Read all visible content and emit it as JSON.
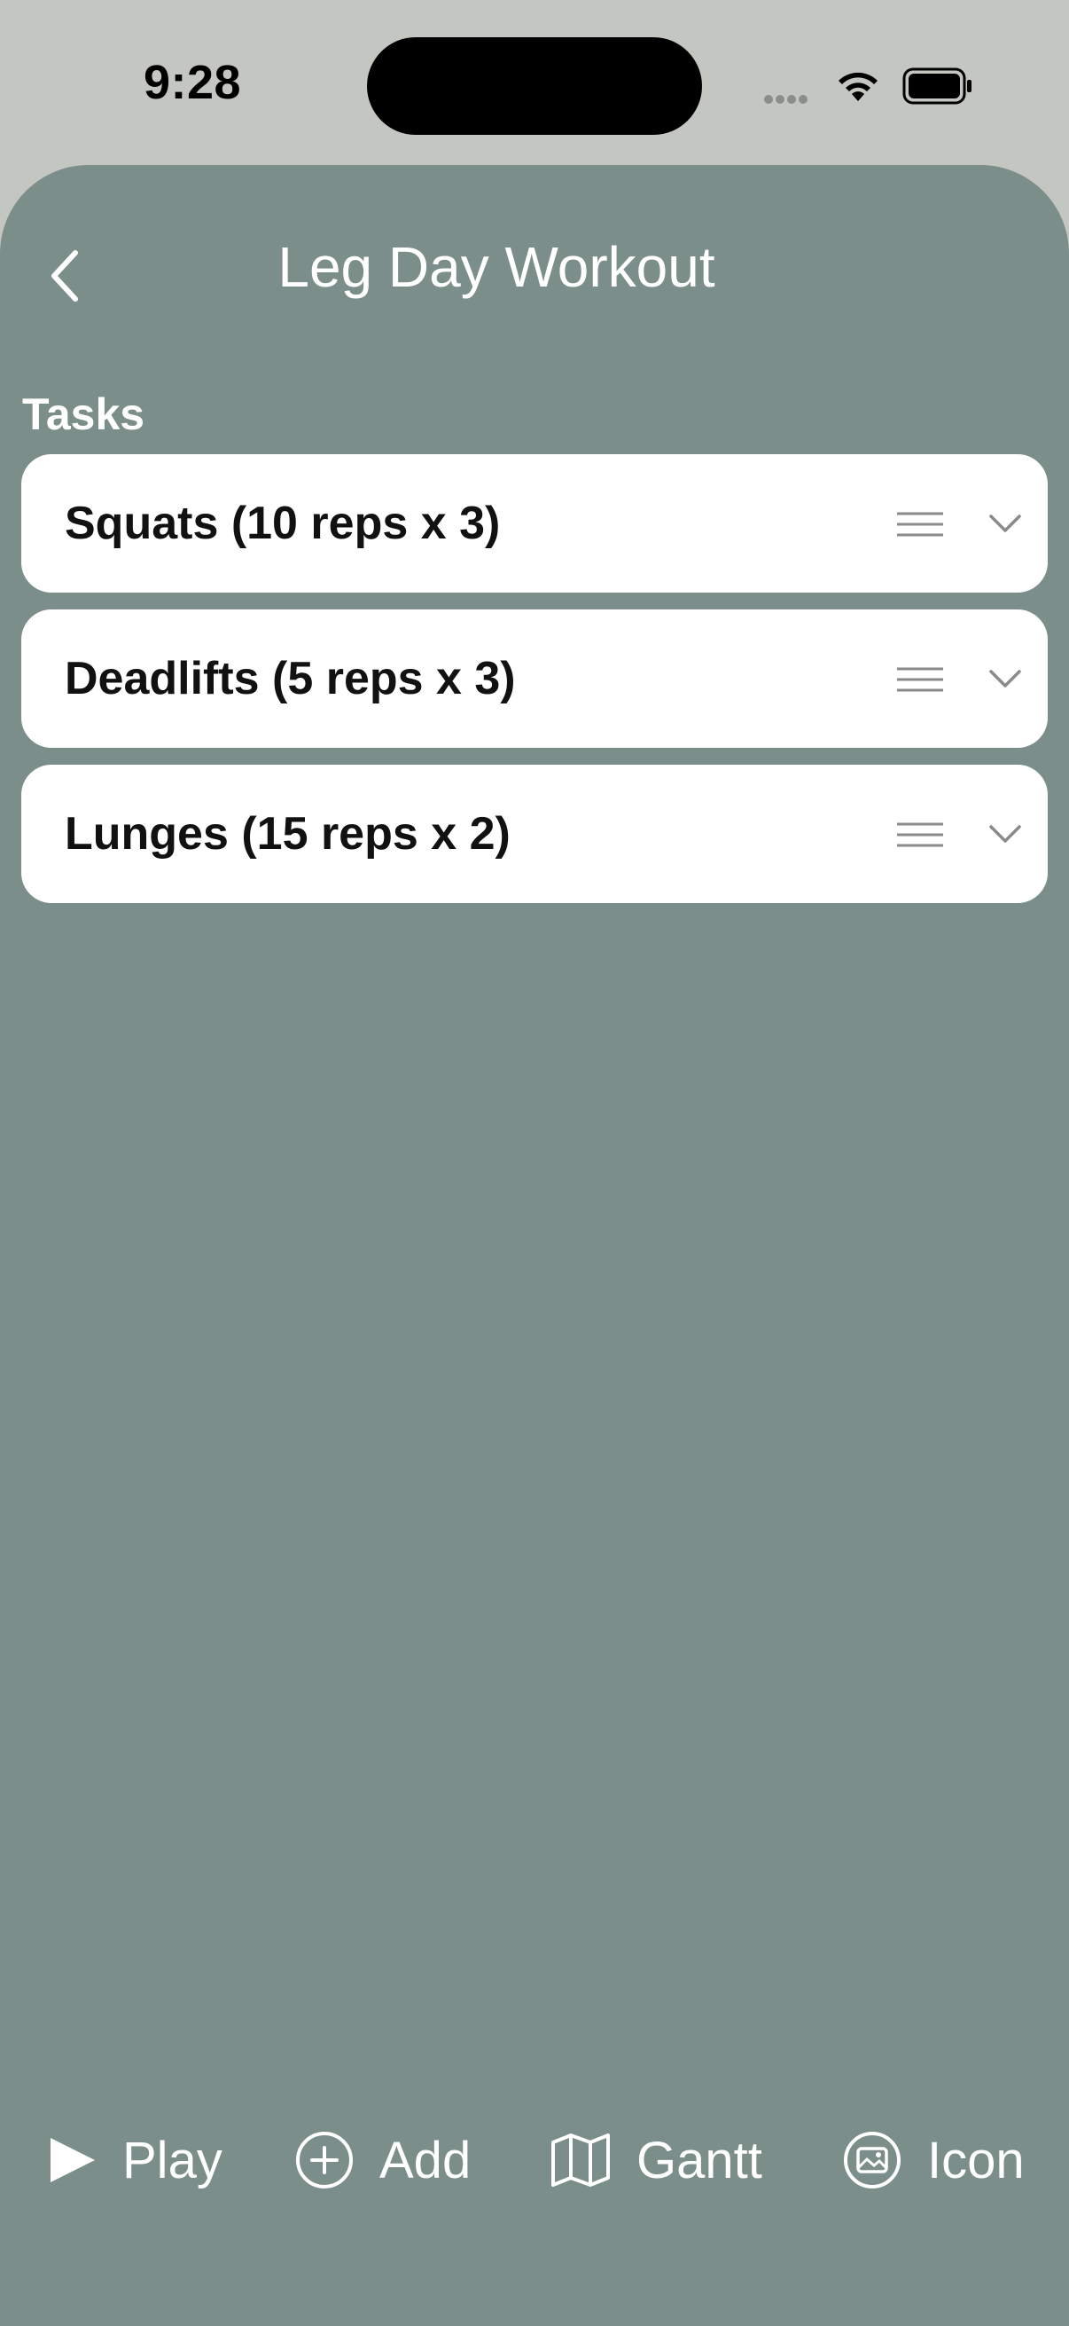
{
  "status_bar": {
    "time": "9:28"
  },
  "header": {
    "title": "Leg Day Workout",
    "back_icon": "chevron-left-icon"
  },
  "section": {
    "label": "Tasks"
  },
  "tasks": [
    {
      "title": "Squats (10 reps x 3)"
    },
    {
      "title": "Deadlifts (5 reps x 3)"
    },
    {
      "title": "Lunges (15 reps x 2)"
    }
  ],
  "toolbar": {
    "play_label": "Play",
    "add_label": "Add",
    "gantt_label": "Gantt",
    "icon_label": "Icon"
  },
  "colors": {
    "sheet_background": "#7b8e89",
    "status_background": "#c4c7c1",
    "card_background": "#ffffff"
  }
}
